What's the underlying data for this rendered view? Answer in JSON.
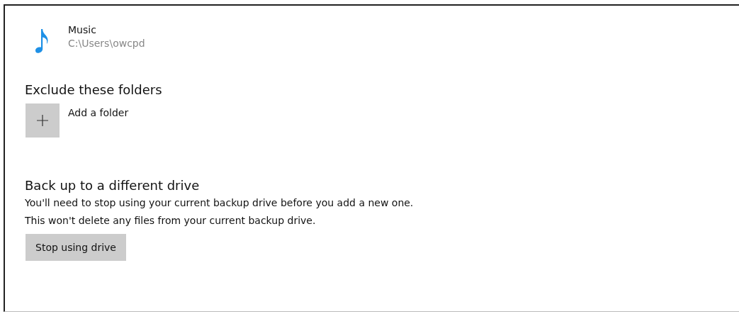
{
  "folder": {
    "name": "Music",
    "path": "C:\\Users\\owcpd"
  },
  "exclude_section": {
    "heading": "Exclude these folders",
    "add_label": "Add a folder"
  },
  "backup_section": {
    "heading": "Back up to a different drive",
    "description": "You'll need to stop using your current backup drive before you add a new one. This won't delete any files from your current backup drive.",
    "button": "Stop using drive"
  }
}
